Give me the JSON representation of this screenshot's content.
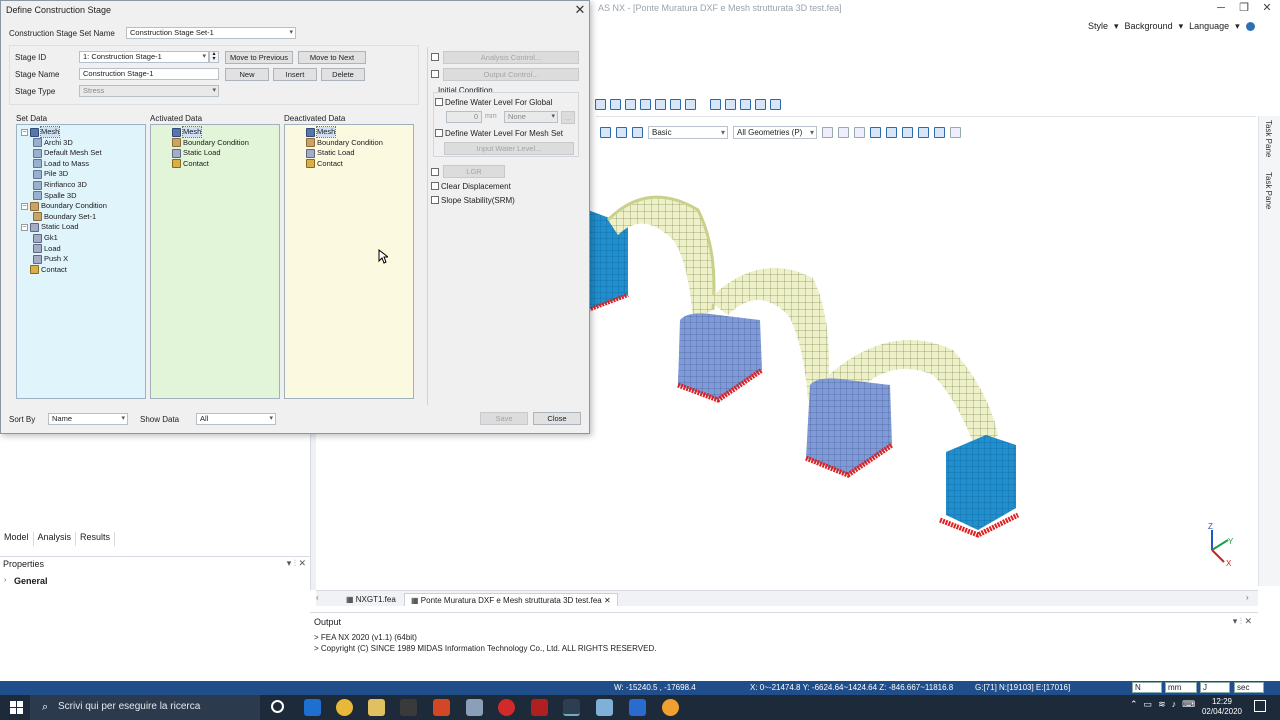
{
  "app": {
    "title": "AS NX - [Ponte Muratura DXF e Mesh strutturata 3D test.fea]",
    "menu_right": [
      "Style",
      "Background",
      "Language"
    ],
    "task_pane_labels": [
      "Task Pane",
      "Task Pane"
    ],
    "view_toolbar": {
      "filter_value": "Basic",
      "geometry_value": "All Geometries (P)"
    },
    "left_tabs": [
      "Model",
      "Analysis",
      "Results"
    ],
    "properties": {
      "title": "Properties",
      "group": "General"
    },
    "doc_tabs": [
      "NXGT1.fea",
      "Ponte Muratura DXF e Mesh strutturata 3D test.fea"
    ],
    "output": {
      "title": "Output",
      "lines": [
        "> FEA NX 2020 (v1.1) (64bit)",
        "> Copyright (C) SINCE 1989 MIDAS Information Technology Co., Ltd. ALL RIGHTS RESERVED."
      ]
    },
    "status": {
      "coords1": "W: -15240.5 , -17698.4",
      "coords2": "X: 0~-21474.8 Y: -6624.64~1424.64 Z: -846.667~11816.8",
      "counts": "G:[71] N:[19103] E:[17016]",
      "unit_force": "N",
      "unit_length": "mm",
      "unit_energy": "J",
      "unit_time": "sec"
    },
    "triad": {
      "z": "Z",
      "y": "Y",
      "x": "X"
    }
  },
  "taskbar": {
    "search_placeholder": "Scrivi qui per eseguire la ricerca",
    "time": "12:29",
    "date": "02/04/2020"
  },
  "dialog": {
    "title": "Define Construction Stage",
    "set_name_label": "Construction Stage Set Name",
    "set_name_value": "Construction Stage Set-1",
    "stage_id_label": "Stage ID",
    "stage_id_value": "1: Construction Stage-1",
    "stage_name_label": "Stage Name",
    "stage_name_value": "Construction Stage-1",
    "stage_type_label": "Stage Type",
    "stage_type_value": "Stress",
    "buttons": {
      "move_prev": "Move to Previous",
      "move_next": "Move to Next",
      "new": "New",
      "insert": "Insert",
      "delete": "Delete",
      "save": "Save",
      "close": "Close"
    },
    "set_data_label": "Set Data",
    "activated_label": "Activated Data",
    "deactivated_label": "Deactivated Data",
    "set_tree": [
      {
        "label": "Mesh",
        "level": 0,
        "icon": "mesh",
        "expander": "-",
        "selected": true
      },
      {
        "label": "Archi 3D",
        "level": 1,
        "icon": "sub"
      },
      {
        "label": "Default Mesh Set",
        "level": 1,
        "icon": "sub"
      },
      {
        "label": "Load to Mass",
        "level": 1,
        "icon": "sub"
      },
      {
        "label": "Pile 3D",
        "level": 1,
        "icon": "sub"
      },
      {
        "label": "Rinfianco 3D",
        "level": 1,
        "icon": "sub"
      },
      {
        "label": "Spalle 3D",
        "level": 1,
        "icon": "sub"
      },
      {
        "label": "Boundary Condition",
        "level": 0,
        "icon": "bc",
        "expander": "-"
      },
      {
        "label": "Boundary Set-1",
        "level": 1,
        "icon": "bc"
      },
      {
        "label": "Static Load",
        "level": 0,
        "icon": "load",
        "expander": "-"
      },
      {
        "label": "Gk1",
        "level": 1,
        "icon": "load"
      },
      {
        "label": "Load",
        "level": 1,
        "icon": "load"
      },
      {
        "label": "Push X",
        "level": 1,
        "icon": "load"
      },
      {
        "label": "Contact",
        "level": 0,
        "icon": "contact"
      }
    ],
    "activated_tree": [
      {
        "label": "Mesh",
        "icon": "mesh",
        "selected": true
      },
      {
        "label": "Boundary Condition",
        "icon": "bc"
      },
      {
        "label": "Static Load",
        "icon": "load"
      },
      {
        "label": "Contact",
        "icon": "contact"
      }
    ],
    "deactivated_tree": [
      {
        "label": "Mesh",
        "icon": "mesh",
        "selected": true
      },
      {
        "label": "Boundary Condition",
        "icon": "bc"
      },
      {
        "label": "Static Load",
        "icon": "load"
      },
      {
        "label": "Contact",
        "icon": "contact"
      }
    ],
    "right": {
      "analysis_control": "Analysis Control...",
      "output_control": "Output Control...",
      "initial_condition": "Initial Condition",
      "water_global": "Define Water Level For Global",
      "water_value": "0",
      "water_unit": "mm",
      "water_combo": "None",
      "water_mesh": "Define Water Level For Mesh Set",
      "input_water": "Input Water Level...",
      "lgr": "LGR",
      "clear_disp": "Clear Displacement",
      "slope": "Slope Stability(SRM)"
    },
    "sort_by_label": "Sort By",
    "sort_by_value": "Name",
    "show_data_label": "Show Data",
    "show_data_value": "All"
  }
}
